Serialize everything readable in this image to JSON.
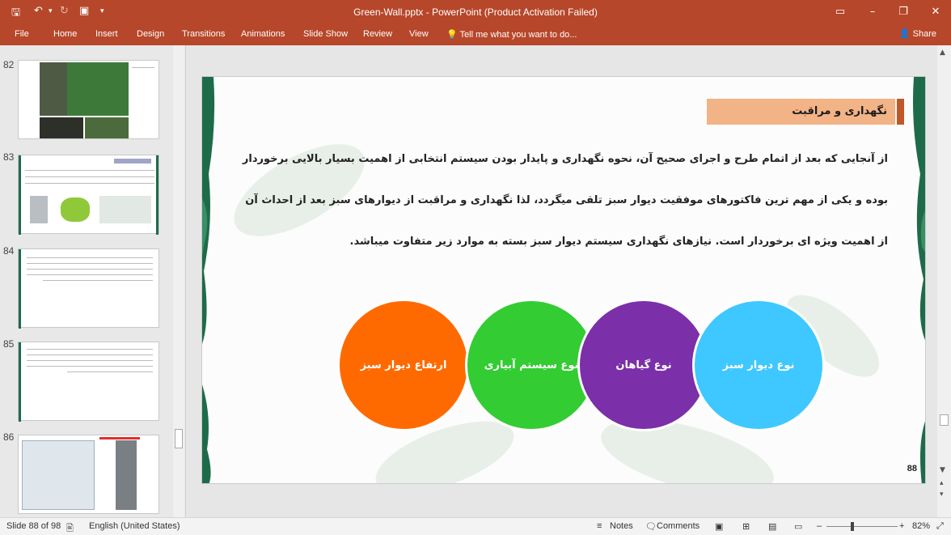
{
  "window": {
    "title": "Green-Wall.pptx - PowerPoint (Product Activation Failed)"
  },
  "ribbon": {
    "tabs": [
      "File",
      "Home",
      "Insert",
      "Design",
      "Transitions",
      "Animations",
      "Slide Show",
      "Review",
      "View"
    ],
    "tell_me": "Tell me what you want to do...",
    "share": "Share"
  },
  "thumbnails": [
    {
      "number": "82"
    },
    {
      "number": "83"
    },
    {
      "number": "84"
    },
    {
      "number": "85"
    },
    {
      "number": "86"
    }
  ],
  "slide": {
    "heading": "نگهداری و مراقبت",
    "body": "از آنجایی که بعد از اتمام طرح و اجرای صحیح آن، نحوه نگهداری و پایدار بودن سیستم انتخابی از اهمیت بسیار بالایی برخوردار بوده و یکی از مهم ترین فاکتورهای موفقیت دیوار سبز تلقی میگردد، لذا نگهداری و مراقبت از دیوارهای سبز بعد از احداث آن از اهمیت ویژه ای برخوردار است. نیازهای نگهداری سیستم دیوار سبز بسته به موارد زیر متفاوت میباشد.",
    "circles": [
      {
        "label": "ارتفاع دیوار سبز",
        "color": "#ff6a00"
      },
      {
        "label": "نوع سیستم آبیاری",
        "color": "#33cc33"
      },
      {
        "label": "نوع گیاهان",
        "color": "#7b2fa8"
      },
      {
        "label": "نوع دیوار سبز",
        "color": "#3ec8ff"
      }
    ],
    "number": "88"
  },
  "status": {
    "slide_counter": "Slide 88 of 98",
    "language": "English (United States)",
    "notes": "Notes",
    "comments": "Comments",
    "zoom": "82%"
  }
}
